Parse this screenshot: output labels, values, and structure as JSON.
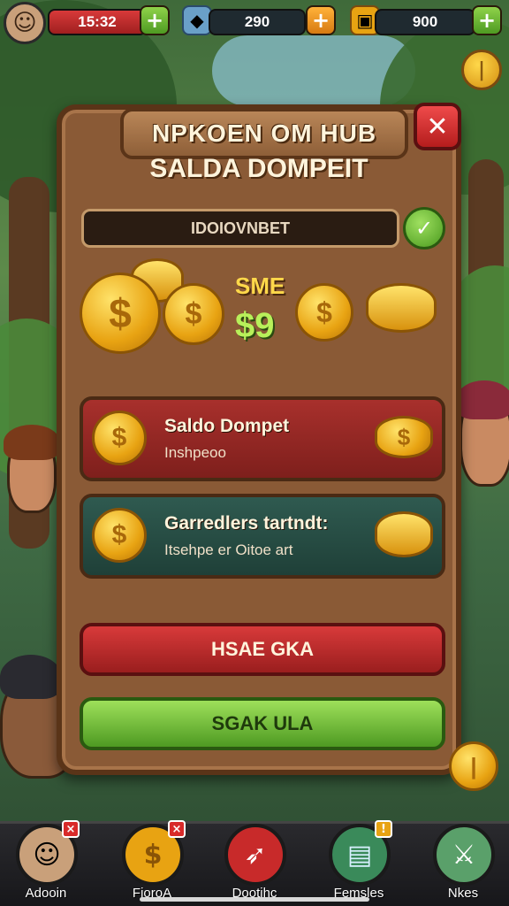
{
  "top_bar": {
    "timer": "15:32",
    "gems": "290",
    "crates": "900"
  },
  "panel": {
    "title": "NPKOEN OM HUB",
    "subtitle": "SALDA DOMPEIT",
    "input_value": "IDOIOVNBET",
    "label_sme": "SME",
    "amount": "$9",
    "cards": [
      {
        "title": "Saldo Dompet",
        "subtitle": "Inshpeoo"
      },
      {
        "title": "Garredlers tartndt:",
        "subtitle": "Itsehpe er Oitoe art"
      }
    ],
    "button_red": "HSAE GKA",
    "button_green": "SGAK ULA"
  },
  "bottom_nav": [
    {
      "label": "Adooin",
      "icon": "avatar-icon",
      "color": "#c9a07a"
    },
    {
      "label": "FioroA",
      "icon": "coin-icon",
      "color": "#e8a312"
    },
    {
      "label": "Dootihc",
      "icon": "rocket-icon",
      "color": "#c82a2a"
    },
    {
      "label": "Femsles",
      "icon": "chest-icon",
      "color": "#3a8a5a"
    },
    {
      "label": "Nkes",
      "icon": "sword-icon",
      "color": "#5aa06a"
    }
  ]
}
